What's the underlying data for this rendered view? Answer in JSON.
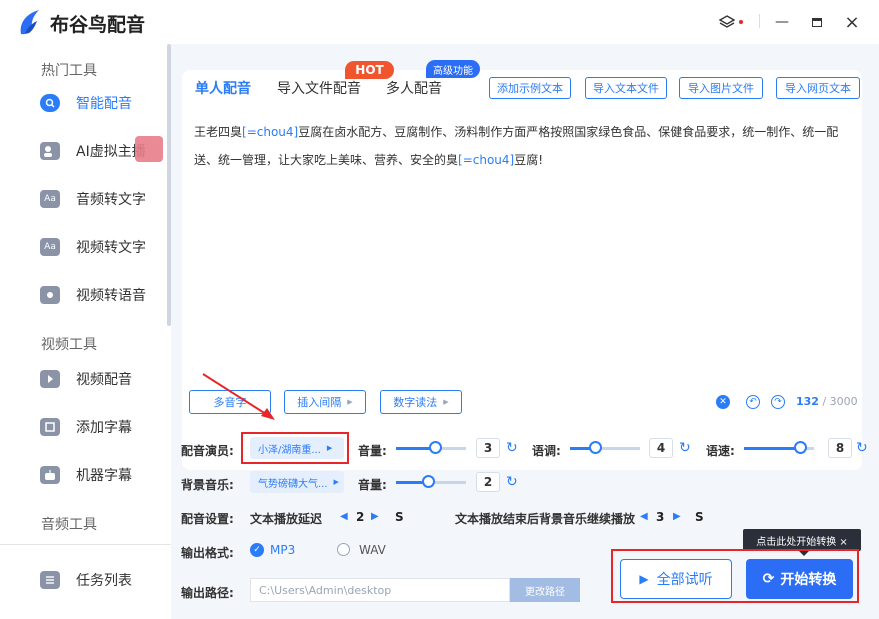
{
  "app": {
    "title": "布谷鸟配音"
  },
  "window_controls": {
    "theme_icon": "layers-icon",
    "minimize": "—",
    "maximize": "▢",
    "close": "×"
  },
  "sidebar": {
    "sections": [
      {
        "label": "热门工具"
      },
      {
        "label": "视频工具"
      },
      {
        "label": "音频工具"
      }
    ],
    "items": [
      {
        "label": "智能配音",
        "icon": "mic-icon",
        "active": true
      },
      {
        "label": "AI虚拟主播",
        "icon": "avatar-icon"
      },
      {
        "label": "音频转文字",
        "icon": "audio-text-icon"
      },
      {
        "label": "视频转文字",
        "icon": "video-text-icon"
      },
      {
        "label": "视频转语音",
        "icon": "video-voice-icon"
      },
      {
        "label": "视频配音",
        "icon": "video-dub-icon"
      },
      {
        "label": "添加字幕",
        "icon": "subtitle-icon"
      },
      {
        "label": "机器字幕",
        "icon": "robot-icon"
      },
      {
        "label": "任务列表",
        "icon": "task-list-icon"
      }
    ]
  },
  "tabs": [
    {
      "label": "单人配音",
      "active": true
    },
    {
      "label": "导入文件配音"
    },
    {
      "label": "多人配音"
    }
  ],
  "badges": {
    "hot": "HOT",
    "advanced": "高级功能"
  },
  "toolbar": {
    "add_sample": "添加示例文本",
    "import_text": "导入文本文件",
    "import_image": "导入图片文件",
    "import_web": "导入网页文本"
  },
  "content": {
    "p1": "王老四臭",
    "ph1": "[=chou4]",
    "p2": "豆腐在卤水配方、豆腐制作、汤料制作方面严格按照国家绿色食品、保健食品要求，统一制作、统一配送、统一管理，让大家吃上美味、营养、安全的臭",
    "ph2": "[=chou4]",
    "p3": "豆腐!"
  },
  "edit_tools": {
    "polyphone": "多音字",
    "insert_pause": "插入间隔",
    "number_reading": "数字读法",
    "char_count": "132",
    "char_limit": " / 3000"
  },
  "settings": {
    "voice_label": "配音演员:",
    "voice_value": "小泽/湖南重...",
    "volume_label": "音量:",
    "volume_value": "3",
    "pitch_label": "语调:",
    "pitch_value": "4",
    "speed_label": "语速:",
    "speed_value": "8",
    "volume_level": 0.55,
    "pitch_level": 0.35,
    "speed_level": 0.8,
    "bgm_label": "背景音乐:",
    "bgm_value": "气势磅礴大气...",
    "bgm_volume_label": "音量:",
    "bgm_volume_value": "2",
    "bgm_volume_level": 0.45,
    "config_label": "配音设置:",
    "delay_label": "文本播放延迟",
    "delay_value": "2",
    "delay_unit": "S",
    "bgm_continue_label": "文本播放结束后背景音乐继续播放",
    "bgm_continue_value": "3",
    "bgm_continue_unit": "S",
    "format_label": "输出格式:",
    "format_mp3": "MP3",
    "format_wav": "WAV",
    "path_label": "输出路径:",
    "path_value": "C:\\Users\\Admin\\desktop",
    "path_button": "更改路径"
  },
  "actions": {
    "preview_all": "全部试听",
    "start": "开始转换",
    "tooltip": "点击此处开始转换 ×"
  },
  "colors": {
    "accent": "#2b7cf7",
    "hot": "#f0552e",
    "annotation": "#e8262a"
  }
}
